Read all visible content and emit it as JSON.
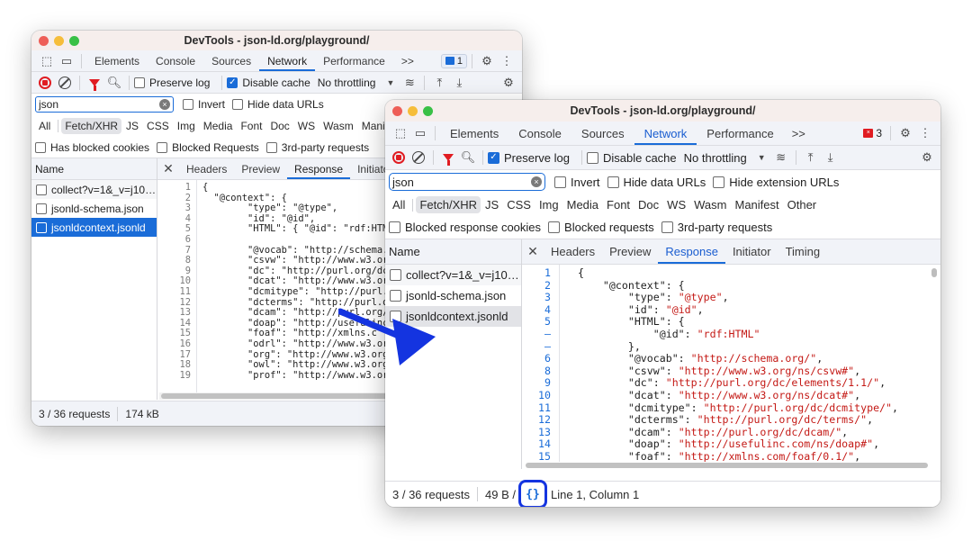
{
  "back_window": {
    "title": "DevTools - json-ld.org/playground/",
    "tabs": [
      "Elements",
      "Console",
      "Sources",
      "Network",
      "Performance"
    ],
    "active_tab": "Network",
    "more_tabs": ">>",
    "message_count": "1",
    "toolbar": {
      "preserve_log": {
        "label": "Preserve log",
        "checked": false
      },
      "disable_cache": {
        "label": "Disable cache",
        "checked": true
      },
      "throttling": "No throttling"
    },
    "filter": {
      "search_value": "json",
      "invert": "Invert",
      "hide_data_urls": "Hide data URLs"
    },
    "types": [
      "All",
      "Fetch/XHR",
      "JS",
      "CSS",
      "Img",
      "Media",
      "Font",
      "Doc",
      "WS",
      "Wasm",
      "Manifest"
    ],
    "active_type": "Fetch/XHR",
    "blocked": [
      "Has blocked cookies",
      "Blocked Requests",
      "3rd-party requests"
    ],
    "names_header": "Name",
    "requests": [
      "collect?v=1&_v=j10…",
      "jsonld-schema.json",
      "jsonldcontext.jsonld"
    ],
    "selected_request": "jsonldcontext.jsonld",
    "detail_tabs": [
      "Headers",
      "Preview",
      "Response",
      "Initiato"
    ],
    "active_detail_tab": "Response",
    "line_numbers": [
      "1",
      "2",
      "3",
      "4",
      "5",
      "6",
      "7",
      "8",
      "9",
      "10",
      "11",
      "12",
      "13",
      "14",
      "15",
      "16",
      "17",
      "18",
      "19"
    ],
    "code_lines": [
      "{",
      "  \"@context\": {",
      "        \"type\": \"@type\",",
      "        \"id\": \"@id\",",
      "        \"HTML\": { \"@id\": \"rdf:HTML\"",
      "",
      "        \"@vocab\": \"http://schema.o",
      "        \"csvw\": \"http://www.w3.org,",
      "        \"dc\": \"http://purl.org/dc/",
      "        \"dcat\": \"http://www.w3.org,",
      "        \"dcmitype\": \"http://purl.o",
      "        \"dcterms\": \"http://purl.org",
      "        \"dcam\": \"http://purl.org/d",
      "        \"doap\": \"http://usefulinc.",
      "        \"foaf\": \"http://xmlns.c",
      "        \"odrl\": \"http://www.w3.org,",
      "        \"org\": \"http://www.w3.org/",
      "        \"owl\": \"http://www.w3.org/",
      "        \"prof\": \"http://www.w3.org,"
    ],
    "status": {
      "requests": "3 / 36 requests",
      "size": "174 kB"
    }
  },
  "front_window": {
    "title": "DevTools - json-ld.org/playground/",
    "tabs": [
      "Elements",
      "Console",
      "Sources",
      "Network",
      "Performance"
    ],
    "active_tab": "Network",
    "more_tabs": ">>",
    "error_count": "3",
    "toolbar": {
      "preserve_log": {
        "label": "Preserve log",
        "checked": true
      },
      "disable_cache": {
        "label": "Disable cache",
        "checked": false
      },
      "throttling": "No throttling"
    },
    "filter": {
      "search_value": "json",
      "invert": "Invert",
      "hide_data_urls": "Hide data URLs",
      "hide_extension_urls": "Hide extension URLs"
    },
    "types": [
      "All",
      "Fetch/XHR",
      "JS",
      "CSS",
      "Img",
      "Media",
      "Font",
      "Doc",
      "WS",
      "Wasm",
      "Manifest",
      "Other"
    ],
    "active_type": "Fetch/XHR",
    "blocked": [
      "Blocked response cookies",
      "Blocked requests",
      "3rd-party requests"
    ],
    "names_header": "Name",
    "requests": [
      "collect?v=1&_v=j10…",
      "jsonld-schema.json",
      "jsonldcontext.jsonld"
    ],
    "selected_request": "jsonldcontext.jsonld",
    "detail_tabs": [
      "Headers",
      "Preview",
      "Response",
      "Initiator",
      "Timing"
    ],
    "active_detail_tab": "Response",
    "line_numbers": [
      "1",
      "2",
      "3",
      "4",
      "5",
      "–",
      "–",
      "6",
      "8",
      "9",
      "10",
      "11",
      "12",
      "13",
      "14",
      "15"
    ],
    "code_lines": [
      [
        {
          "t": "{"
        }
      ],
      [
        {
          "t": "    \"@context\": {"
        }
      ],
      [
        {
          "t": "        \"type\": "
        },
        {
          "s": "\"@type\""
        },
        {
          "t": ","
        }
      ],
      [
        {
          "t": "        \"id\": "
        },
        {
          "s": "\"@id\""
        },
        {
          "t": ","
        }
      ],
      [
        {
          "t": "        \"HTML\": {"
        }
      ],
      [
        {
          "t": "            \"@id\": "
        },
        {
          "s": "\"rdf:HTML\""
        }
      ],
      [
        {
          "t": "        },"
        }
      ],
      [
        {
          "t": "        \"@vocab\": "
        },
        {
          "s": "\"http://schema.org/\""
        },
        {
          "t": ","
        }
      ],
      [
        {
          "t": "        \"csvw\": "
        },
        {
          "s": "\"http://www.w3.org/ns/csvw#\""
        },
        {
          "t": ","
        }
      ],
      [
        {
          "t": "        \"dc\": "
        },
        {
          "s": "\"http://purl.org/dc/elements/1.1/\""
        },
        {
          "t": ","
        }
      ],
      [
        {
          "t": "        \"dcat\": "
        },
        {
          "s": "\"http://www.w3.org/ns/dcat#\""
        },
        {
          "t": ","
        }
      ],
      [
        {
          "t": "        \"dcmitype\": "
        },
        {
          "s": "\"http://purl.org/dc/dcmitype/\""
        },
        {
          "t": ","
        }
      ],
      [
        {
          "t": "        \"dcterms\": "
        },
        {
          "s": "\"http://purl.org/dc/terms/\""
        },
        {
          "t": ","
        }
      ],
      [
        {
          "t": "        \"dcam\": "
        },
        {
          "s": "\"http://purl.org/dc/dcam/\""
        },
        {
          "t": ","
        }
      ],
      [
        {
          "t": "        \"doap\": "
        },
        {
          "s": "\"http://usefulinc.com/ns/doap#\""
        },
        {
          "t": ","
        }
      ],
      [
        {
          "t": "        \"foaf\": "
        },
        {
          "s": "\"http://xmlns.com/foaf/0.1/\""
        },
        {
          "t": ","
        }
      ]
    ],
    "status": {
      "requests": "3 / 36 requests",
      "size": "49 B /",
      "pretty_print": "{}",
      "cursor": "Line 1, Column 1"
    }
  },
  "annotation": {
    "arrow_color": "#1434e0",
    "highlight_color": "#1434e0"
  }
}
